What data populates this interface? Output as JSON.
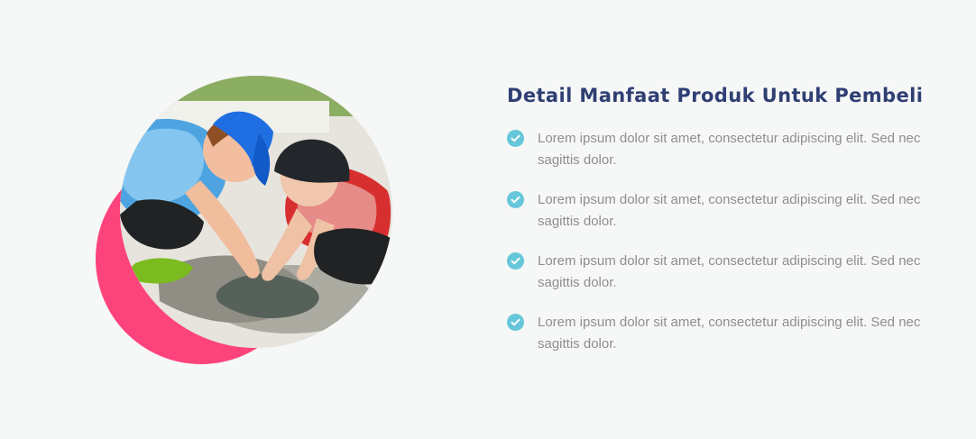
{
  "feature": {
    "title": "Detail Manfaat Produk Untuk Pembeli",
    "benefits": [
      {
        "text": "Lorem ipsum dolor sit amet, consectetur adipiscing elit. Sed nec sagittis dolor."
      },
      {
        "text": "Lorem ipsum dolor sit amet, consectetur adipiscing elit. Sed nec sagittis dolor."
      },
      {
        "text": "Lorem ipsum dolor sit amet, consectetur adipiscing elit. Sed nec sagittis dolor."
      },
      {
        "text": "Lorem ipsum dolor sit amet, consectetur adipiscing elit. Sed nec sagittis dolor."
      }
    ]
  },
  "colors": {
    "page_background": "#f6f7f7",
    "title": "#2f3f73",
    "body_text": "#8e8e8e",
    "check_icon": "#67c7da",
    "accent_shape": "#fd437c"
  },
  "icons": {
    "benefit_marker": "check-circle-icon",
    "photo": "children-playing-photo"
  }
}
